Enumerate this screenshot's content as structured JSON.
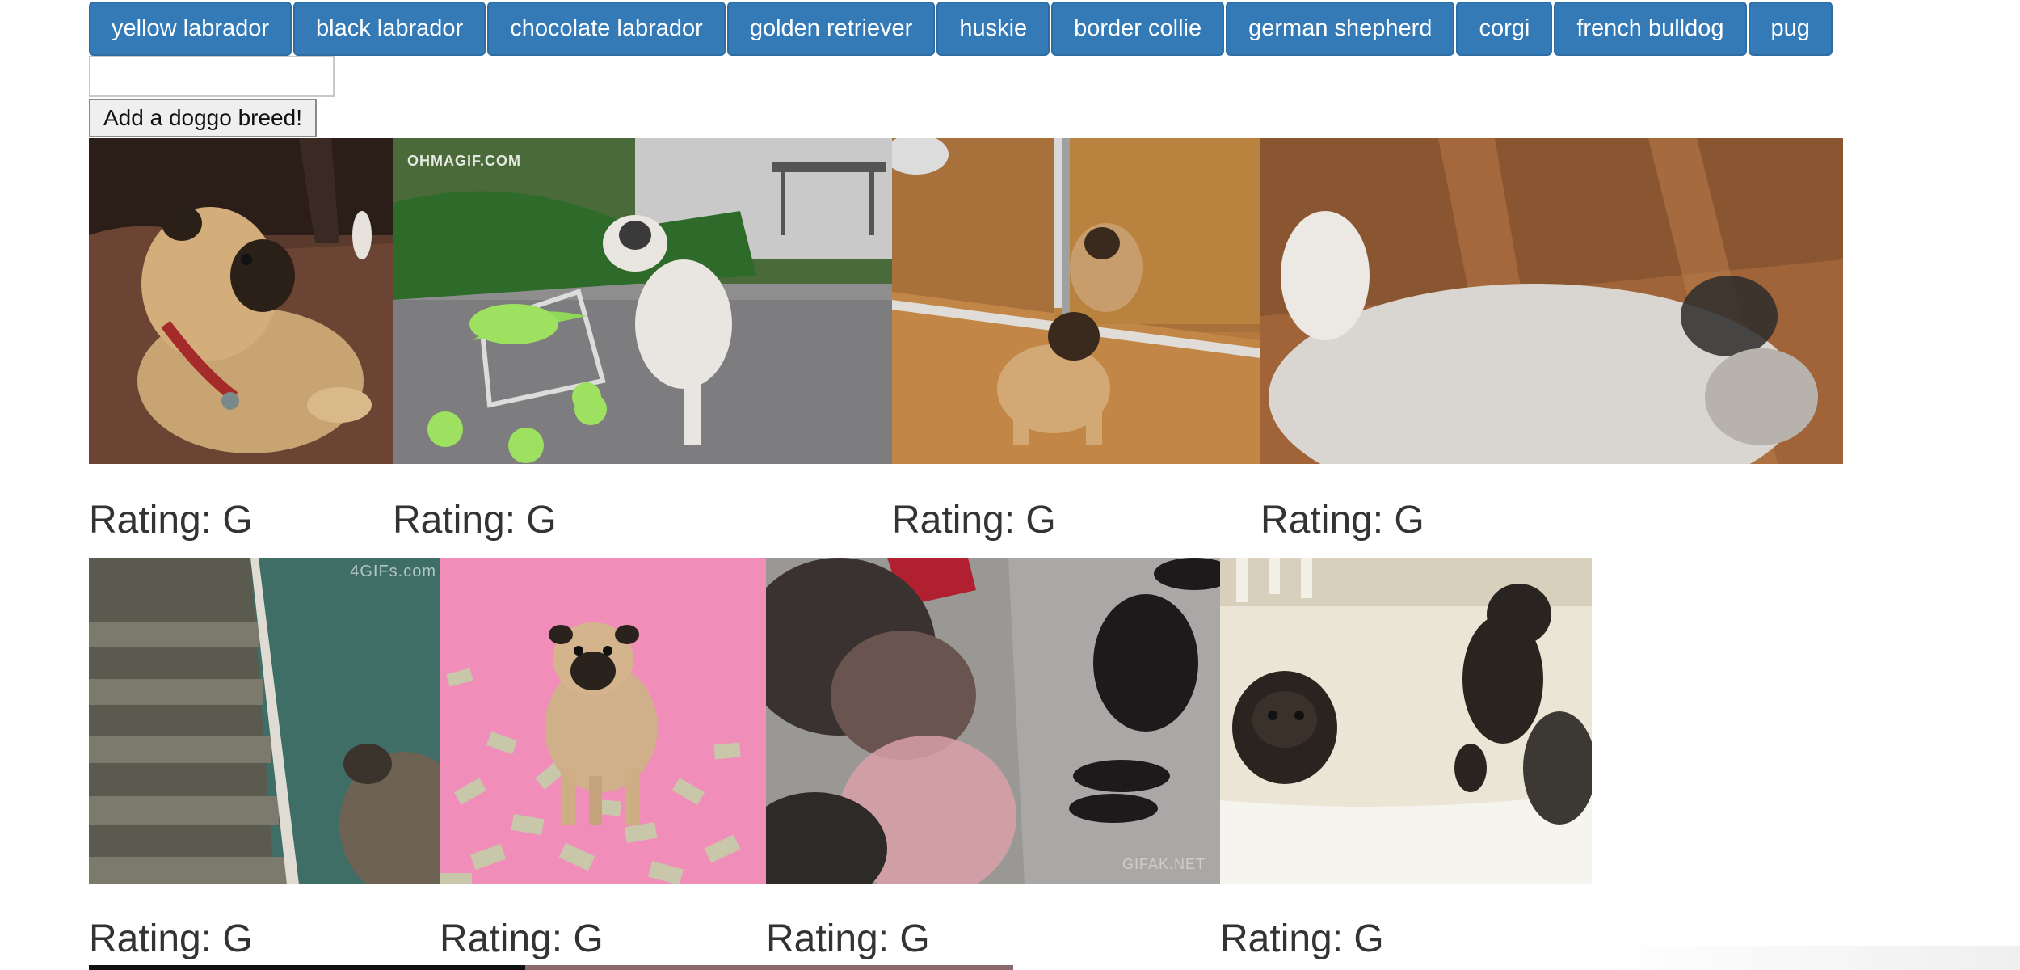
{
  "breed_buttons": [
    "yellow labrador",
    "black labrador",
    "chocolate labrador",
    "golden retriever",
    "huskie",
    "border collie",
    "german shepherd",
    "corgi",
    "french bulldog",
    "pug"
  ],
  "add_form": {
    "input_value": "",
    "submit_label": "Add a doggo breed!"
  },
  "gifs": [
    {
      "rating": "Rating: G"
    },
    {
      "rating": "Rating: G",
      "watermark": "OHMAGIF.COM"
    },
    {
      "rating": "Rating: G"
    },
    {
      "rating": "Rating: G"
    },
    {
      "rating": "Rating: G",
      "watermark": "4GIFs.com"
    },
    {
      "rating": "Rating: G"
    },
    {
      "rating": "Rating: G",
      "watermark": "GIFAK.NET"
    },
    {
      "rating": "Rating: G"
    }
  ],
  "colors": {
    "button_bg": "#337ab7",
    "button_border": "#2e6da4",
    "rating_text": "#333333"
  }
}
